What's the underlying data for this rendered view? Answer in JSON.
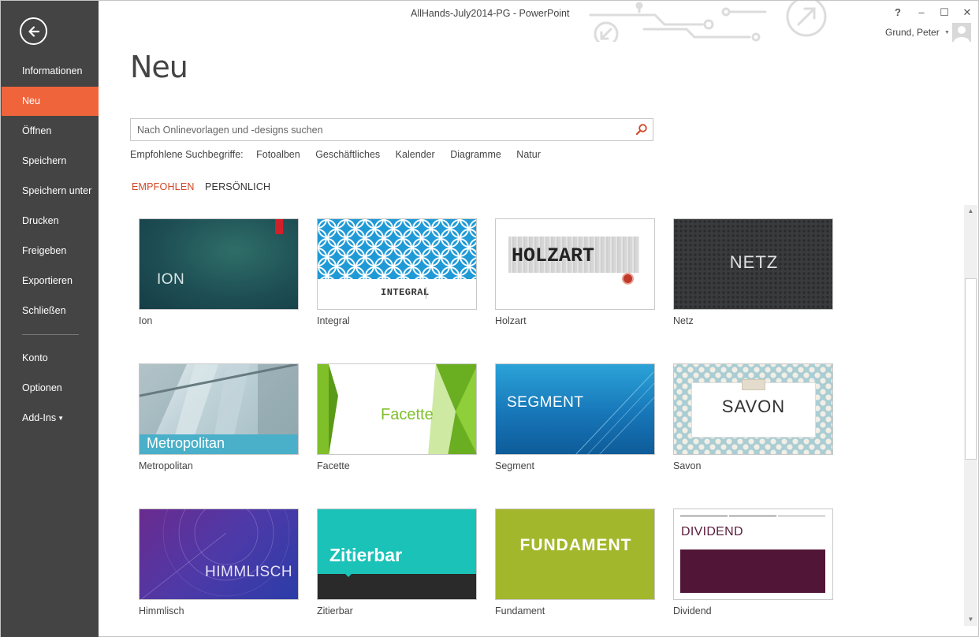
{
  "window": {
    "title": "AllHands-July2014-PG - PowerPoint",
    "help_label": "?",
    "minimize_label": "–",
    "maximize_label": "☐",
    "close_label": "✕",
    "user_name": "Grund, Peter"
  },
  "sidebar": {
    "items": [
      {
        "label": "Informationen"
      },
      {
        "label": "Neu"
      },
      {
        "label": "Öffnen"
      },
      {
        "label": "Speichern"
      },
      {
        "label": "Speichern unter"
      },
      {
        "label": "Drucken"
      },
      {
        "label": "Freigeben"
      },
      {
        "label": "Exportieren"
      },
      {
        "label": "Schließen"
      },
      {
        "label": "Konto"
      },
      {
        "label": "Optionen"
      },
      {
        "label": "Add-Ins"
      }
    ],
    "active": "Neu"
  },
  "main": {
    "title": "Neu",
    "search": {
      "placeholder": "Nach Onlinevorlagen und -designs suchen",
      "value": ""
    },
    "suggestions_label": "Empfohlene Suchbegriffe:",
    "suggestions": [
      "Fotoalben",
      "Geschäftliches",
      "Kalender",
      "Diagramme",
      "Natur"
    ],
    "tabs": [
      {
        "label": "EMPFOHLEN",
        "active": true
      },
      {
        "label": "PERSÖNLICH",
        "active": false
      }
    ],
    "templates": [
      {
        "name": "Ion",
        "thumb_text": "ION"
      },
      {
        "name": "Integral",
        "thumb_text": "INTEGRAL"
      },
      {
        "name": "Holzart",
        "thumb_text": "HOLZART"
      },
      {
        "name": "Netz",
        "thumb_text": "NETZ"
      },
      {
        "name": "Metropolitan",
        "thumb_text": "Metropolitan"
      },
      {
        "name": "Facette",
        "thumb_text": "Facette"
      },
      {
        "name": "Segment",
        "thumb_text": "SEGMENT"
      },
      {
        "name": "Savon",
        "thumb_text": "SAVON"
      },
      {
        "name": "Himmlisch",
        "thumb_text": "HIMMLISCH"
      },
      {
        "name": "Zitierbar",
        "thumb_text": "Zitierbar"
      },
      {
        "name": "Fundament",
        "thumb_text": "FUNDAMENT"
      },
      {
        "name": "Dividend",
        "thumb_text": "DIVIDEND"
      }
    ]
  },
  "colors": {
    "sidebar_bg": "#444444",
    "accent": "#f0643c",
    "tab_active": "#d24726"
  }
}
